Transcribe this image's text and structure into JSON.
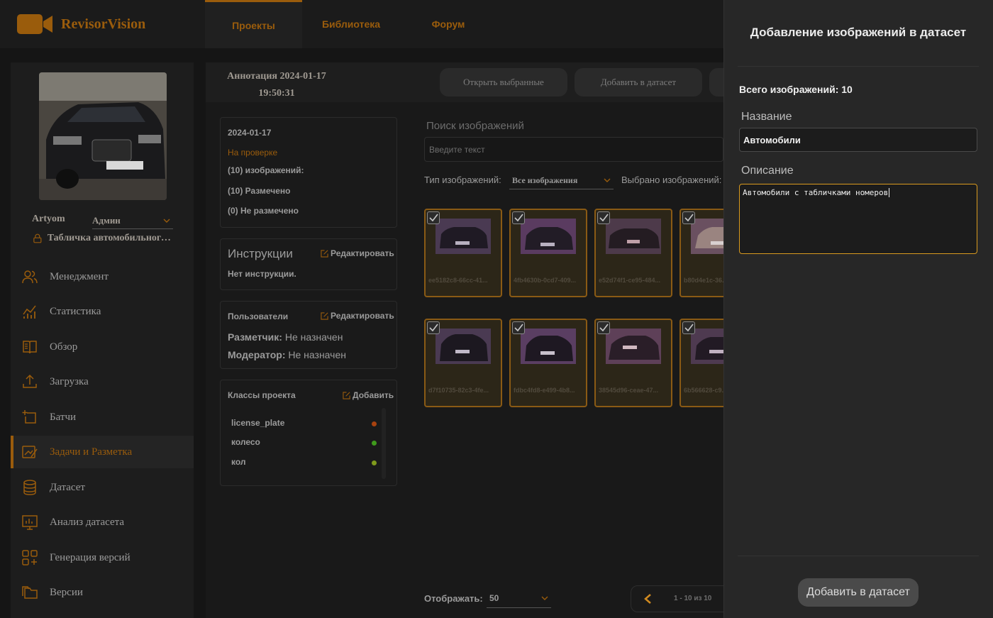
{
  "app": {
    "name": "RevisorVision"
  },
  "tabs": [
    {
      "label": "Проекты",
      "active": true
    },
    {
      "label": "Библиотека",
      "active": false
    },
    {
      "label": "Форум",
      "active": false
    }
  ],
  "user": {
    "name": "Artyom",
    "role": "Админ",
    "project": "Табличка автомобильного номера"
  },
  "nav": [
    {
      "label": "Менеджмент",
      "icon": "users-icon"
    },
    {
      "label": "Статистика",
      "icon": "stats-icon"
    },
    {
      "label": "Обзор",
      "icon": "book-icon"
    },
    {
      "label": "Загрузка",
      "icon": "upload-icon"
    },
    {
      "label": "Батчи",
      "icon": "batch-icon"
    },
    {
      "label": "Задачи и Разметка",
      "icon": "annotate-icon",
      "active": true
    },
    {
      "label": "Датасет",
      "icon": "database-icon"
    },
    {
      "label": "Анализ датасета",
      "icon": "analysis-icon"
    },
    {
      "label": "Генерация версий",
      "icon": "grid-plus-icon"
    },
    {
      "label": "Версии",
      "icon": "folders-icon"
    }
  ],
  "annotation": {
    "title": "Аннотация 2024-01-17",
    "time": "19:50:31"
  },
  "header_buttons": {
    "open_selected": "Открыть выбранные",
    "add_to_dataset": "Добавить в датасет"
  },
  "info_card": {
    "date": "2024-01-17",
    "status": "На проверке",
    "images": "(10) изображений:",
    "marked": "(10) Размечено",
    "unmarked": "(0) Не размечено"
  },
  "instructions": {
    "title": "Инструкции",
    "edit": "Редактировать",
    "text": "Нет инструкции."
  },
  "users_card": {
    "title": "Пользователи",
    "edit": "Редактировать",
    "annotator_label": "Разметчик:",
    "annotator_value": "Не назначен",
    "moderator_label": "Модератор:",
    "moderator_value": "Не назначен"
  },
  "classes": {
    "title": "Классы проекта",
    "add": "Добавить",
    "items": [
      {
        "name": "license_plate",
        "color": "#a8420f"
      },
      {
        "name": "колесо",
        "color": "#3f9a1c"
      },
      {
        "name": "кол",
        "color": "#7f9a1c"
      }
    ]
  },
  "search": {
    "label": "Поиск изображений",
    "placeholder": "Введите текст"
  },
  "filter": {
    "type_label": "Тип изображений:",
    "type_value": "Все изображения",
    "selected_label": "Выбрано изображений:"
  },
  "images": [
    "ee5182c8-66cc-41...",
    "4fb4630b-0cd7-409...",
    "e52d74f1-ce95-484...",
    "b80d4e1c-36...",
    "d7f10735-82c3-4fe...",
    "fdbc4fd8-e499-4b8...",
    "38545d96-ceae-47...",
    "6b566628-c9..."
  ],
  "pagination": {
    "show_label": "Отображать:",
    "per_page": "50",
    "range": "1 - 10 из 10"
  },
  "panel": {
    "title": "Добавление изображений в датасет",
    "total": "Всего изображений: 10",
    "name_label": "Название",
    "name_value": "Автомобили",
    "desc_label": "Описание",
    "desc_value": "Автомобили с табличками номеров",
    "submit": "Добавить в датасет"
  },
  "colors": {
    "accent": "#9a5c0c",
    "background": "#151515",
    "panel": "#272727",
    "focus_border": "#d99a1e"
  }
}
